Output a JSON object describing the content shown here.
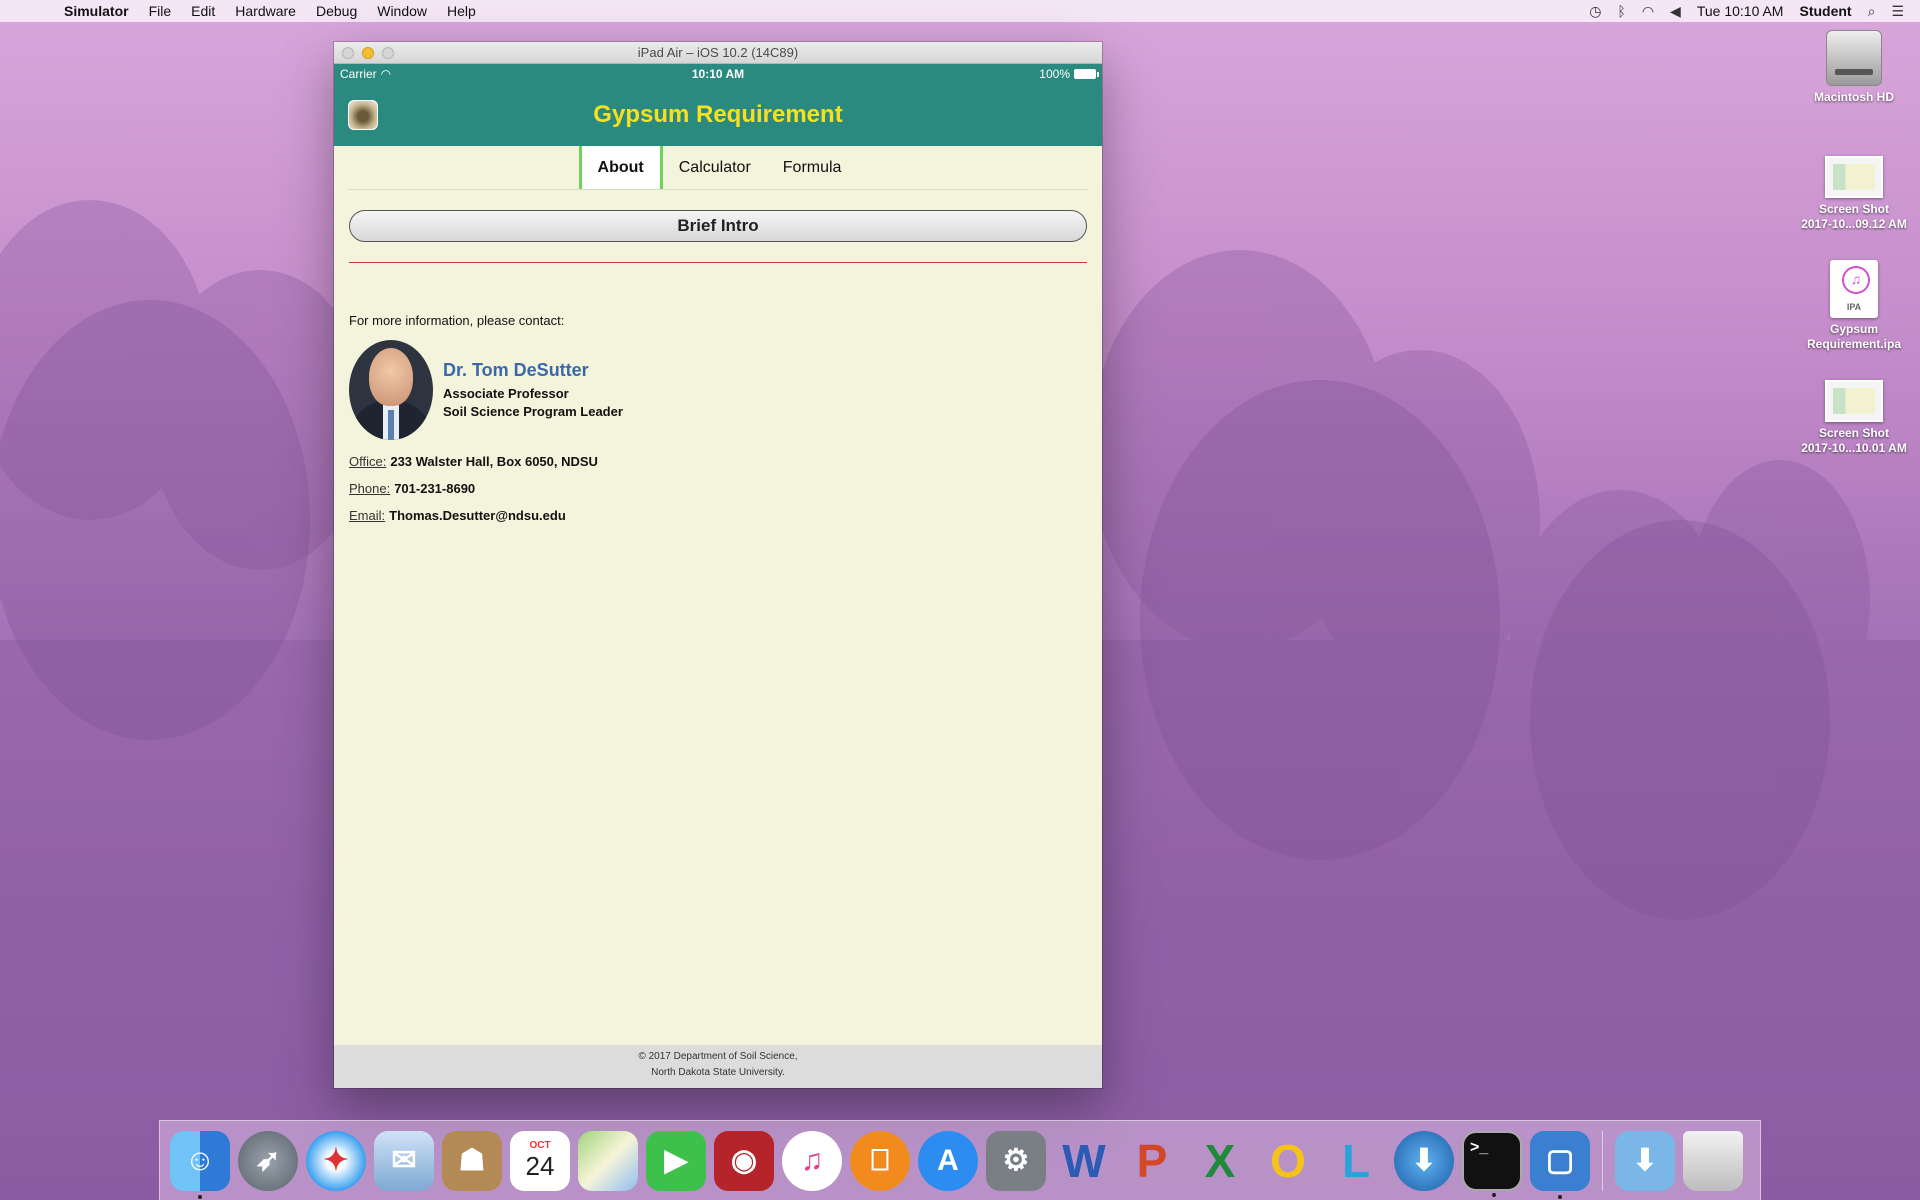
{
  "menubar": {
    "app_name": "Simulator",
    "menus": [
      "File",
      "Edit",
      "Hardware",
      "Debug",
      "Window",
      "Help"
    ],
    "clock": "Tue 10:10 AM",
    "user": "Student"
  },
  "desktop": {
    "icons": [
      {
        "label_line1": "Macintosh HD",
        "label_line2": ""
      },
      {
        "label_line1": "Screen Shot",
        "label_line2": "2017-10...09.12 AM"
      },
      {
        "label_line1": "Gypsum",
        "label_line2": "Requirement.ipa",
        "badge": "IPA"
      },
      {
        "label_line1": "Screen Shot",
        "label_line2": "2017-10...10.01 AM"
      }
    ]
  },
  "window": {
    "title": "iPad Air – iOS 10.2 (14C89)"
  },
  "status_bar": {
    "carrier": "Carrier",
    "time": "10:10 AM",
    "battery": "100%"
  },
  "app": {
    "title": "Gypsum Requirement",
    "tabs": [
      {
        "label": "About",
        "active": true
      },
      {
        "label": "Calculator",
        "active": false
      },
      {
        "label": "Formula",
        "active": false
      }
    ],
    "brief_intro_label": "Brief Intro",
    "contact_intro": "For more information, please contact:",
    "person": {
      "name": "Dr. Tom DeSutter",
      "title": "Associate Professor",
      "role": "Soil Science Program Leader"
    },
    "office": {
      "label": "Office:",
      "value": "233 Walster Hall, Box 6050, NDSU"
    },
    "phone": {
      "label": "Phone:",
      "value": "701-231-8690"
    },
    "email": {
      "label": "Email:",
      "value": "Thomas.Desutter@ndsu.edu"
    },
    "footer_line1": "© 2017 Department of Soil Science,",
    "footer_line2": "North Dakota State University."
  },
  "dock": {
    "apps": [
      "finder-icon",
      "launchpad-icon",
      "safari-icon",
      "mail-icon",
      "contacts-icon",
      "calendar-icon",
      "maps-icon",
      "facetime-icon",
      "photo-booth-icon",
      "itunes-icon",
      "ibooks-icon",
      "app-store-icon",
      "system-preferences-icon",
      "word-icon",
      "powerpoint-icon",
      "excel-icon",
      "outlook-icon",
      "lync-icon",
      "network-utility-icon",
      "terminal-icon",
      "simulator-icon",
      "downloads-icon",
      "trash-icon"
    ],
    "calendar_month": "OCT",
    "calendar_day": "24"
  },
  "colors": {
    "app_header": "#2b8a80",
    "app_title": "#f7e01e",
    "app_background": "#f4f4dc",
    "active_tab_border": "#6ed35a",
    "divider": "#c43c3c",
    "person_name": "#3a68a8"
  }
}
